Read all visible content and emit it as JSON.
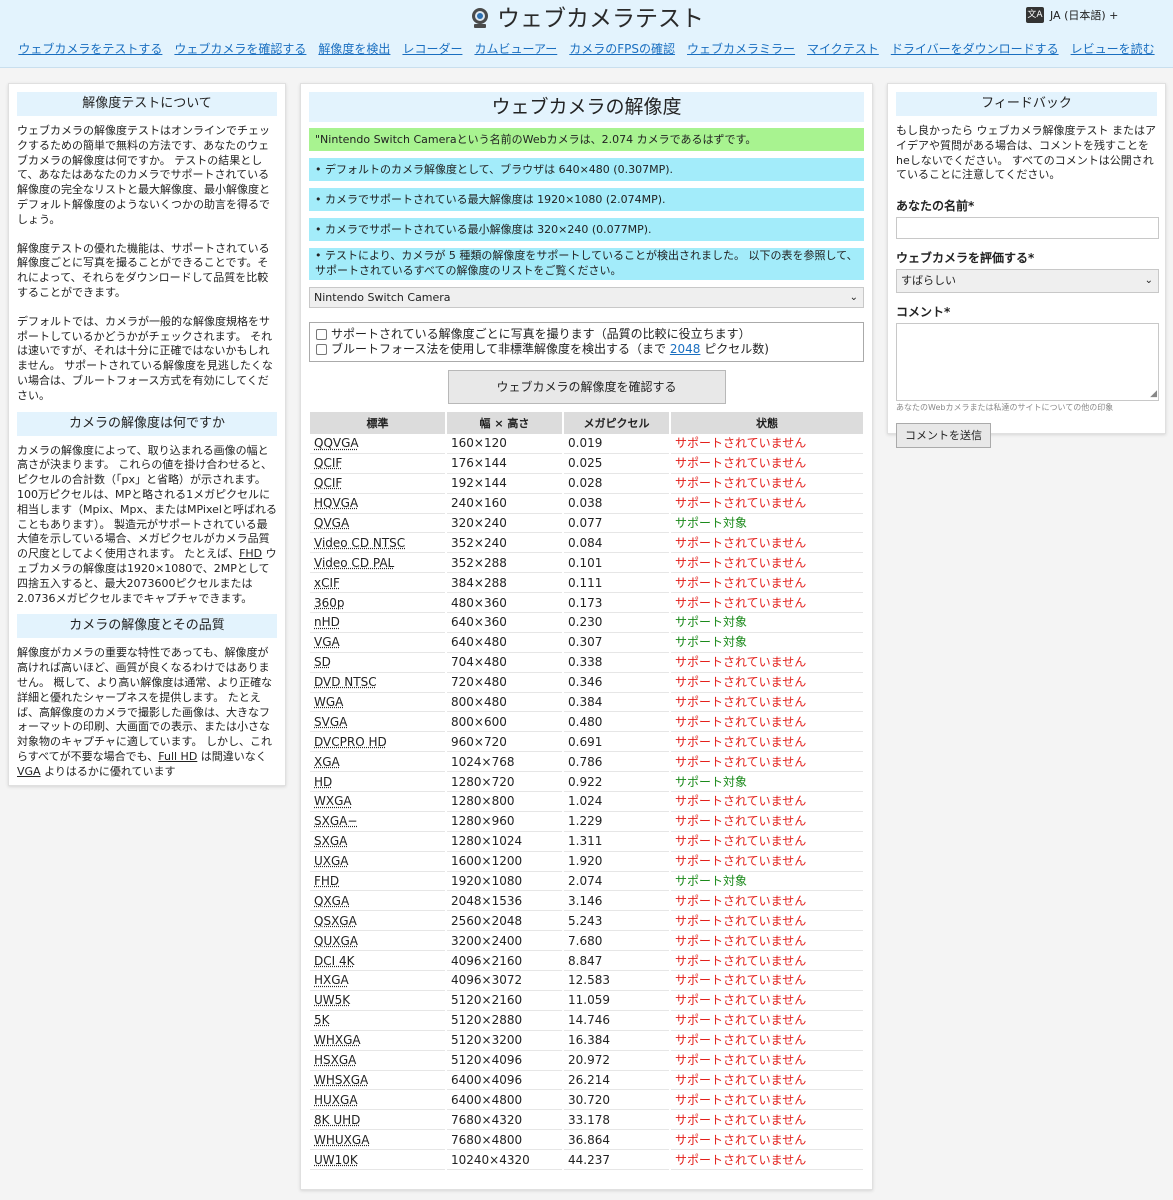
{
  "header": {
    "title": "ウェブカメラテスト",
    "language": "JA (日本語) +",
    "nav": [
      "ウェブカメラをテストする",
      "ウェブカメラを確認する",
      "解像度を検出",
      "レコーダー",
      "カムビューアー",
      "カメラのFPSの確認",
      "ウェブカメラミラー",
      "マイクテスト",
      "ドライバーをダウンロードする",
      "レビューを読む"
    ]
  },
  "left": {
    "s1_title": "解像度テストについて",
    "s1_p1": "ウェブカメラの解像度テストはオンラインでチェックするための簡単で無料の方法です、あなたのウェブカメラの解像度は何ですか。 テストの結果として、あなたはあなたのカメラでサポートされている解像度の完全なリストと最大解像度、最小解像度とデフォルト解像度のようないくつかの助言を得るでしょう。",
    "s1_p2": "解像度テストの優れた機能は、サポートされている解像度ごとに写真を撮ることができることです。それによって、それらをダウンロードして品質を比較することができます。",
    "s1_p3": "デフォルトでは、カメラが一般的な解像度規格をサポートしているかどうかがチェックされます。 それは速いですが、それは十分に正確ではないかもしれません。 サポートされている解像度を見逃したくない場合は、ブルートフォース方式を有効にしてください。",
    "s2_title": "カメラの解像度は何ですか",
    "s2_p1a": "カメラの解像度によって、取り込まれる画像の幅と高さが決まります。 これらの値を掛け合わせると、ピクセルの合計数（「px」と省略）が示されます。 100万ピクセルは、MPと略される1メガピクセルに相当します（Mpix、Mpx、またはMPixelと呼ばれることもあります）。 製造元がサポートされている最大値を示している場合、メガピクセルがカメラ品質の尺度としてよく使用されます。 たとえば、",
    "s2_p1_fhd": "FHD",
    "s2_p1b": " ウェブカメラの解像度は1920×1080で、2MPとして四捨五入すると、最大2073600ピクセルまたは2.0736メガピクセルまでキャプチャできます。",
    "s3_title": "カメラの解像度とその品質",
    "s3_p1a": "解像度がカメラの重要な特性であっても、解像度が高ければ高いほど、画質が良くなるわけではありません。 概して、より高い解像度は通常、より正確な詳細と優れたシャープネスを提供します。 たとえば、高解像度のカメラで撮影した画像は、大きなフォーマットの印刷、大画面での表示、または小さな対象物のキャプチャに適しています。 しかし、これらすべてが不要な場合でも、",
    "s3_p1_fullhd": "Full HD",
    "s3_p1b": " は間違いなく ",
    "s3_p1_vga": "VGA",
    "s3_p1c": " よりはるかに優れています"
  },
  "center": {
    "title": "ウェブカメラの解像度",
    "alert_green": "\"Nintendo Switch Cameraという名前のWebカメラは、2.074 カメラであるはずです。",
    "alert_default": "• デフォルトのカメラ解像度として、ブラウザは 640×480 (0.307MP).",
    "alert_max": "• カメラでサポートされている最大解像度は 1920×1080 (2.074MP).",
    "alert_min": "• カメラでサポートされている最小解像度は 320×240 (0.077MP).",
    "alert_count": "• テストにより、カメラが 5 種類の解像度をサポートしていることが検出されました。 以下の表を参照して、サポートされているすべての解像度のリストをご覧ください。",
    "camera_select": "Nintendo Switch Camera",
    "opt_photo": "サポートされている解像度ごとに写真を撮ります（品質の比較に役立ちます）",
    "opt_brute_a": "ブルートフォース法を使用して非標準解像度を検出する（まで ",
    "opt_brute_link": "2048",
    "opt_brute_b": " ピクセル数)",
    "check_button": "ウェブカメラの解像度を確認する",
    "table_headers": [
      "標準",
      "幅 × 高さ",
      "メガピクセル",
      "状態"
    ],
    "status_ok": "サポート対象",
    "status_ng": "サポートされていません",
    "rows": [
      [
        "QQVGA",
        "160×120",
        "0.019",
        "ng"
      ],
      [
        "QCIF",
        "176×144",
        "0.025",
        "ng"
      ],
      [
        "QCIF",
        "192×144",
        "0.028",
        "ng"
      ],
      [
        "HQVGA",
        "240×160",
        "0.038",
        "ng"
      ],
      [
        "QVGA",
        "320×240",
        "0.077",
        "ok"
      ],
      [
        "Video CD NTSC",
        "352×240",
        "0.084",
        "ng"
      ],
      [
        "Video CD PAL",
        "352×288",
        "0.101",
        "ng"
      ],
      [
        "xCIF",
        "384×288",
        "0.111",
        "ng"
      ],
      [
        "360p",
        "480×360",
        "0.173",
        "ng"
      ],
      [
        "nHD",
        "640×360",
        "0.230",
        "ok"
      ],
      [
        "VGA",
        "640×480",
        "0.307",
        "ok"
      ],
      [
        "SD",
        "704×480",
        "0.338",
        "ng"
      ],
      [
        "DVD NTSC",
        "720×480",
        "0.346",
        "ng"
      ],
      [
        "WGA",
        "800×480",
        "0.384",
        "ng"
      ],
      [
        "SVGA",
        "800×600",
        "0.480",
        "ng"
      ],
      [
        "DVCPRO HD",
        "960×720",
        "0.691",
        "ng"
      ],
      [
        "XGA",
        "1024×768",
        "0.786",
        "ng"
      ],
      [
        "HD",
        "1280×720",
        "0.922",
        "ok"
      ],
      [
        "WXGA",
        "1280×800",
        "1.024",
        "ng"
      ],
      [
        "SXGA−",
        "1280×960",
        "1.229",
        "ng"
      ],
      [
        "SXGA",
        "1280×1024",
        "1.311",
        "ng"
      ],
      [
        "UXGA",
        "1600×1200",
        "1.920",
        "ng"
      ],
      [
        "FHD",
        "1920×1080",
        "2.074",
        "ok"
      ],
      [
        "QXGA",
        "2048×1536",
        "3.146",
        "ng"
      ],
      [
        "QSXGA",
        "2560×2048",
        "5.243",
        "ng"
      ],
      [
        "QUXGA",
        "3200×2400",
        "7.680",
        "ng"
      ],
      [
        "DCI 4K",
        "4096×2160",
        "8.847",
        "ng"
      ],
      [
        "HXGA",
        "4096×3072",
        "12.583",
        "ng"
      ],
      [
        "UW5K",
        "5120×2160",
        "11.059",
        "ng"
      ],
      [
        "5K",
        "5120×2880",
        "14.746",
        "ng"
      ],
      [
        "WHXGA",
        "5120×3200",
        "16.384",
        "ng"
      ],
      [
        "HSXGA",
        "5120×4096",
        "20.972",
        "ng"
      ],
      [
        "WHSXGA",
        "6400×4096",
        "26.214",
        "ng"
      ],
      [
        "HUXGA",
        "6400×4800",
        "30.720",
        "ng"
      ],
      [
        "8K UHD",
        "7680×4320",
        "33.178",
        "ng"
      ],
      [
        "WHUXGA",
        "7680×4800",
        "36.864",
        "ng"
      ],
      [
        "UW10K",
        "10240×4320",
        "44.237",
        "ng"
      ]
    ],
    "colors": {
      "ok": "#1b8a1b",
      "ng": "#e3201b",
      "alert_green": "#a8f390",
      "alert_blue": "#a3ecfa"
    }
  },
  "right": {
    "title": "フィードバック",
    "intro_a": "もし良かったら ウェブカメラ解像度テスト またはアイデアや質問がある場合は、コメントを残すことをheしないでください。 すべてのコメントは公開されていることに注意してください。",
    "name_label": "あなたの名前*",
    "rate_label": "ウェブカメラを評価する*",
    "rate_value": "すばらしい",
    "comment_label": "コメント*",
    "comment_hint": "あなたのWebカメラまたは私達のサイトについての他の印象",
    "submit": "コメントを送信"
  }
}
